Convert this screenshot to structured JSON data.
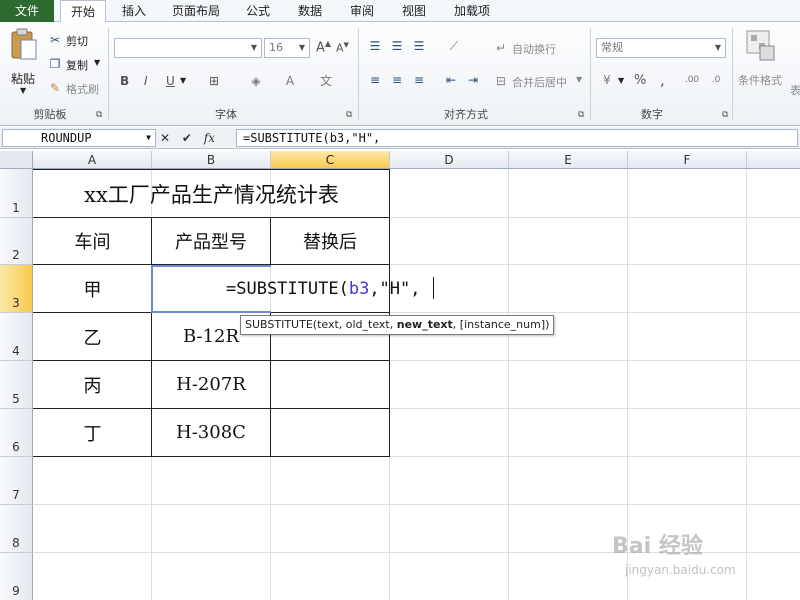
{
  "ribbon_tabs": [
    "文件",
    "开始",
    "插入",
    "页面布局",
    "公式",
    "数据",
    "审阅",
    "视图",
    "加载项"
  ],
  "clipboard": {
    "paste": "粘贴",
    "cut": "剪切",
    "copy": "复制",
    "format_painter": "格式刷",
    "label": "剪贴板"
  },
  "font": {
    "size": "16",
    "bold": "B",
    "italic": "I",
    "underline": "U",
    "label": "字体"
  },
  "alignment": {
    "wrap_text": "自动换行",
    "merge_center": "合并后居中",
    "label": "对齐方式"
  },
  "number": {
    "format": "常规",
    "percent": "%",
    "comma": ",",
    "label": "数字"
  },
  "styles": {
    "conditional_format": "条件格式",
    "table_partial": "表"
  },
  "formula_bar": {
    "name_box": "ROUNDUP",
    "fx": "fx",
    "formula": "=SUBSTITUTE(b3,\"H\","
  },
  "columns": [
    "A",
    "B",
    "C",
    "D",
    "E",
    "F"
  ],
  "rows": [
    "1",
    "2",
    "3",
    "4",
    "5",
    "6",
    "7",
    "8",
    "9"
  ],
  "sheet": {
    "title": "xx工厂产品生产情况统计表",
    "headers": [
      "车间",
      "产品型号",
      "替换后"
    ],
    "workshops": [
      "甲",
      "乙",
      "丙",
      "丁"
    ],
    "models": [
      "",
      "B-12R",
      "H-207R",
      "H-308C"
    ],
    "edit_prefix": "=SUBSTITUTE(",
    "edit_ref": "b3",
    "edit_suffix": ",\"H\","
  },
  "tooltip": {
    "func": "SUBSTITUTE(text, old_text, ",
    "active_arg": "new_text",
    "rest": ", [instance_num])"
  },
  "watermark": {
    "brand": "Bai 经验",
    "url": "jingyan.baidu.com"
  }
}
